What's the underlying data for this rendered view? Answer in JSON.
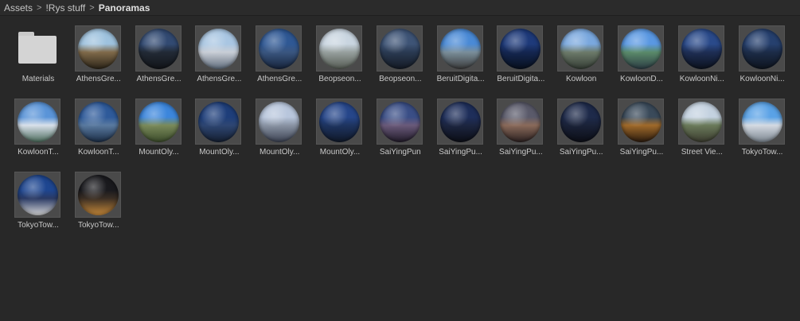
{
  "breadcrumb": {
    "items": [
      "Assets",
      "!Rys stuff",
      "Panoramas"
    ]
  },
  "assets": [
    {
      "label": "Materials",
      "kind": "folder"
    },
    {
      "label": "AthensGre...",
      "kind": "panorama",
      "colors": [
        "#9ec2de",
        "#806a4a",
        "#2b2418"
      ]
    },
    {
      "label": "AthensGre...",
      "kind": "panorama",
      "colors": [
        "#324a72",
        "#222a36",
        "#121418"
      ]
    },
    {
      "label": "AthensGre...",
      "kind": "panorama",
      "colors": [
        "#a9c6e2",
        "#c9ced6",
        "#5f6c7c"
      ]
    },
    {
      "label": "AthensGre...",
      "kind": "panorama",
      "colors": [
        "#2f5894",
        "#3a5680",
        "#16233a"
      ]
    },
    {
      "label": "Beopseon...",
      "kind": "panorama",
      "colors": [
        "#c9d5e0",
        "#97a09e",
        "#545a52"
      ]
    },
    {
      "label": "Beopseon...",
      "kind": "panorama",
      "colors": [
        "#3e5476",
        "#2a3a52",
        "#141a24"
      ]
    },
    {
      "label": "BeruitDigita...",
      "kind": "panorama",
      "colors": [
        "#4a8ad6",
        "#7a8e9a",
        "#3a3a3a"
      ]
    },
    {
      "label": "BeruitDigita...",
      "kind": "panorama",
      "colors": [
        "#1e3a7a",
        "#142650",
        "#08101e"
      ]
    },
    {
      "label": "Kowloon",
      "kind": "panorama",
      "colors": [
        "#7aa8de",
        "#6c7a6a",
        "#343c34"
      ]
    },
    {
      "label": "KowloonD...",
      "kind": "panorama",
      "colors": [
        "#5a98e2",
        "#5a8a6a",
        "#2c3c44"
      ]
    },
    {
      "label": "KowloonNi...",
      "kind": "panorama",
      "colors": [
        "#2a4a8a",
        "#1e2e54",
        "#0c121e"
      ]
    },
    {
      "label": "KowloonNi...",
      "kind": "panorama",
      "colors": [
        "#26406e",
        "#1c2c48",
        "#0e141e"
      ]
    },
    {
      "label": "KowloonT...",
      "kind": "panorama",
      "colors": [
        "#5a94d8",
        "#d8e0ea",
        "#4a6a5a"
      ]
    },
    {
      "label": "KowloonT...",
      "kind": "panorama",
      "colors": [
        "#2e5a9a",
        "#5a7aa0",
        "#1a2c44"
      ]
    },
    {
      "label": "MountOly...",
      "kind": "panorama",
      "colors": [
        "#3c86dc",
        "#7a8a5a",
        "#3a4a2a"
      ]
    },
    {
      "label": "MountOly...",
      "kind": "panorama",
      "colors": [
        "#1e3e7a",
        "#2e4672",
        "#141e30"
      ]
    },
    {
      "label": "MountOly...",
      "kind": "panorama",
      "colors": [
        "#b8c6dc",
        "#8a94a4",
        "#3a4050"
      ]
    },
    {
      "label": "MountOly...",
      "kind": "panorama",
      "colors": [
        "#26468a",
        "#1e3460",
        "#101828"
      ]
    },
    {
      "label": "SaiYingPun",
      "kind": "panorama",
      "colors": [
        "#3a4e86",
        "#6a5a7a",
        "#201a28"
      ]
    },
    {
      "label": "SaiYingPu...",
      "kind": "panorama",
      "colors": [
        "#1e2e5a",
        "#1c2540",
        "#0c0e16"
      ]
    },
    {
      "label": "SaiYingPu...",
      "kind": "panorama",
      "colors": [
        "#5a5a6a",
        "#8a6a5a",
        "#2a2020"
      ]
    },
    {
      "label": "SaiYingPu...",
      "kind": "panorama",
      "colors": [
        "#1e2a4a",
        "#1a2238",
        "#0c0e16"
      ]
    },
    {
      "label": "SaiYingPu...",
      "kind": "panorama",
      "colors": [
        "#3a4a5a",
        "#a06a2a",
        "#2a1a0e"
      ]
    },
    {
      "label": "Street Vie...",
      "kind": "panorama",
      "colors": [
        "#c4d2e0",
        "#6a7a5a",
        "#3a3a2e"
      ]
    },
    {
      "label": "TokyoTow...",
      "kind": "panorama",
      "colors": [
        "#5aa2e6",
        "#d4dae2",
        "#7a848e"
      ]
    },
    {
      "label": "TokyoTow...",
      "kind": "panorama",
      "colors": [
        "#1e4690",
        "#2a3a64",
        "#d8d8d8"
      ]
    },
    {
      "label": "TokyoTow...",
      "kind": "panorama",
      "colors": [
        "#1a1a1e",
        "#3a2e24",
        "#c88a3a"
      ]
    }
  ]
}
